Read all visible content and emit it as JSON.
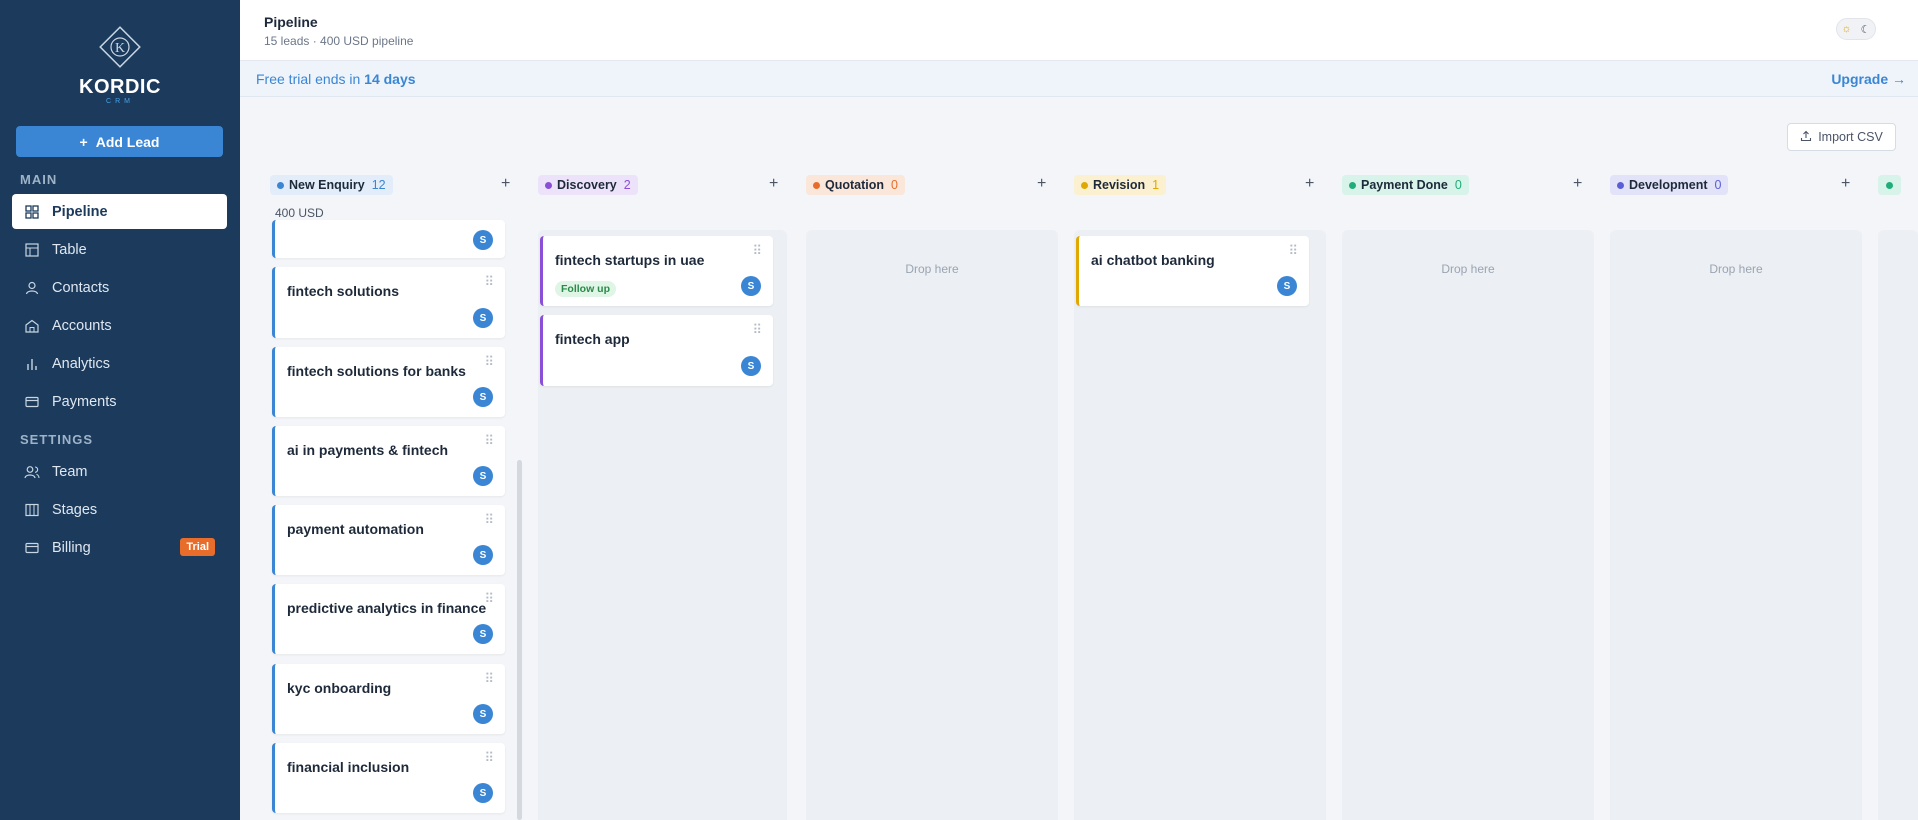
{
  "sidebar": {
    "logo_text": "KORDIC",
    "logo_sub": "CRM",
    "add_lead": "Add Lead",
    "section_main": "MAIN",
    "section_settings": "SETTINGS",
    "items": [
      {
        "label": "Pipeline",
        "icon": "grid-icon"
      },
      {
        "label": "Table",
        "icon": "table-icon"
      },
      {
        "label": "Contacts",
        "icon": "user-icon"
      },
      {
        "label": "Accounts",
        "icon": "building-icon"
      },
      {
        "label": "Analytics",
        "icon": "bar-chart-icon"
      },
      {
        "label": "Payments",
        "icon": "credit-card-icon"
      },
      {
        "label": "Team",
        "icon": "users-icon"
      },
      {
        "label": "Stages",
        "icon": "columns-icon"
      },
      {
        "label": "Billing",
        "icon": "credit-card-icon",
        "badge": "Trial"
      }
    ]
  },
  "header": {
    "title": "Pipeline",
    "subtitle": "15 leads · 400 USD pipeline"
  },
  "trial": {
    "prefix": "Free trial ends in ",
    "days": "14 days",
    "upgrade": "Upgrade →"
  },
  "toolbar": {
    "import_csv": "Import CSV"
  },
  "stages": [
    {
      "name": "New Enquiry",
      "count": "12",
      "color": "#3a86d4",
      "bg": "#e2edf9",
      "total": "400 USD"
    },
    {
      "name": "Discovery",
      "count": "2",
      "color": "#8a4fd6",
      "bg": "#ece3fa"
    },
    {
      "name": "Quotation",
      "count": "0",
      "color": "#e86d2a",
      "bg": "#fbe6da"
    },
    {
      "name": "Revision",
      "count": "1",
      "color": "#e0a800",
      "bg": "#fbf0cf"
    },
    {
      "name": "Payment Done",
      "count": "0",
      "color": "#1fae7a",
      "bg": "#d8f3e9"
    },
    {
      "name": "Development",
      "count": "0",
      "color": "#5b5fd6",
      "bg": "#e2e3f8"
    }
  ],
  "drop_text": "Drop here",
  "cards": {
    "new_enquiry": [
      {
        "title": ""
      },
      {
        "title": "fintech solutions"
      },
      {
        "title": "fintech solutions for banks"
      },
      {
        "title": "ai in payments & fintech"
      },
      {
        "title": "payment automation"
      },
      {
        "title": "predictive analytics in finance"
      },
      {
        "title": "kyc onboarding"
      },
      {
        "title": "financial inclusion"
      }
    ],
    "discovery": [
      {
        "title": "fintech startups in uae",
        "tag": "Follow up"
      },
      {
        "title": "fintech app"
      }
    ],
    "revision": [
      {
        "title": "ai chatbot banking"
      }
    ]
  },
  "avatar_initial": "S"
}
